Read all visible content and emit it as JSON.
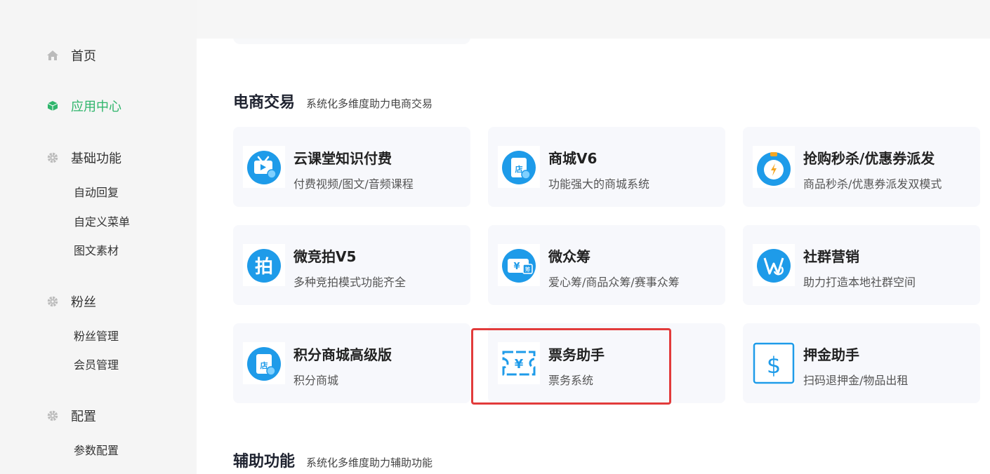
{
  "sidebar": {
    "home": "首页",
    "app_center": "应用中心",
    "basic": "基础功能",
    "basic_items": [
      "自动回复",
      "自定义菜单",
      "图文素材"
    ],
    "fans": "粉丝",
    "fans_items": [
      "粉丝管理",
      "会员管理"
    ],
    "config": "配置",
    "config_items": [
      "参数配置"
    ],
    "accent_color": "#2fb56b"
  },
  "section_ecommerce": {
    "title": "电商交易",
    "subtitle": "系统化多维度助力电商交易",
    "cards": [
      {
        "name": "云课堂知识付费",
        "desc": "付费视频/图文/音频课程",
        "icon": "video-course-icon"
      },
      {
        "name": "商城V6",
        "desc": "功能强大的商城系统",
        "icon": "mall-store-icon"
      },
      {
        "name": "抢购秒杀/优惠券派发",
        "desc": "商品秒杀/优惠券派发双模式",
        "icon": "stopwatch-icon"
      },
      {
        "name": "微竞拍V5",
        "desc": "多种竞拍模式功能齐全",
        "icon": "auction-icon"
      },
      {
        "name": "微众筹",
        "desc": "爱心筹/商品众筹/赛事众筹",
        "icon": "crowdfunding-icon"
      },
      {
        "name": "社群营销",
        "desc": "助力打造本地社群空间",
        "icon": "community-icon"
      },
      {
        "name": "积分商城高级版",
        "desc": "积分商城",
        "icon": "points-mall-icon"
      },
      {
        "name": "票务助手",
        "desc": "票务系统",
        "icon": "ticket-icon"
      },
      {
        "name": "押金助手",
        "desc": "扫码退押金/物品出租",
        "icon": "deposit-icon"
      }
    ]
  },
  "section_assist": {
    "title": "辅助功能",
    "subtitle": "系统化多维度助力辅助功能"
  }
}
